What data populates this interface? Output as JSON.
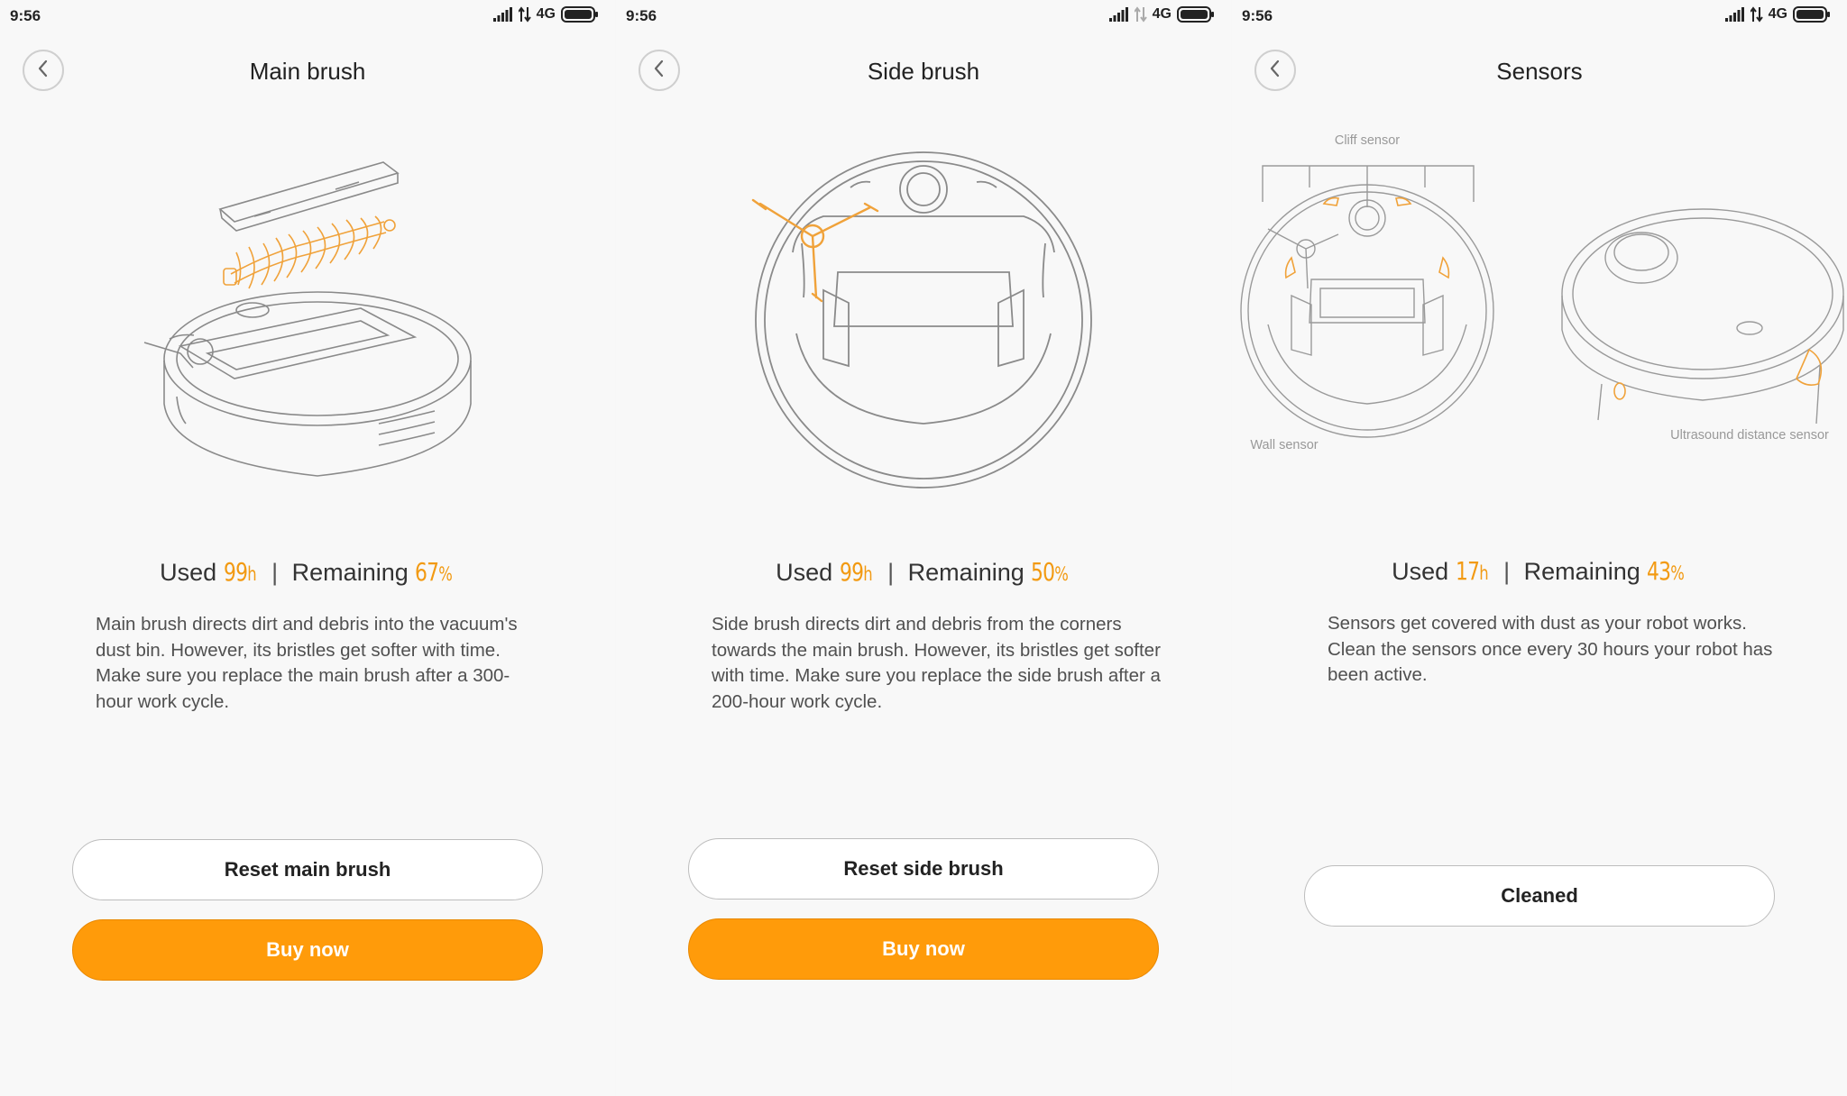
{
  "colors": {
    "accent": "#f29a12",
    "primary_button": "#ff9b0a",
    "background": "#f8f8f8"
  },
  "panels": [
    {
      "status": {
        "time": "9:56",
        "network": "4G"
      },
      "title": "Main brush",
      "usage": {
        "used_label": "Used",
        "used_value": "99",
        "used_unit": "h",
        "remaining_label": "Remaining",
        "remaining_value": "67",
        "remaining_unit": "%"
      },
      "description": "Main brush directs dirt and debris into the vacuum's dust bin. However, its bristles get softer with time. Make sure you replace the main brush after a 300-hour work cycle.",
      "buttons": {
        "reset": "Reset main brush",
        "buy": "Buy now"
      }
    },
    {
      "status": {
        "time": "9:56",
        "network": "4G"
      },
      "title": "Side brush",
      "usage": {
        "used_label": "Used",
        "used_value": "99",
        "used_unit": "h",
        "remaining_label": "Remaining",
        "remaining_value": "50",
        "remaining_unit": "%"
      },
      "description": "Side brush directs dirt and debris from the corners towards the main brush. However, its bristles get softer with time. Make sure you replace the side brush after a 200-hour work cycle.",
      "buttons": {
        "reset": "Reset side brush",
        "buy": "Buy now"
      }
    },
    {
      "status": {
        "time": "9:56",
        "network": "4G"
      },
      "title": "Sensors",
      "sensor_labels": {
        "cliff": "Cliff sensor",
        "wall": "Wall sensor",
        "ultrasound": "Ultrasound distance sensor"
      },
      "usage": {
        "used_label": "Used",
        "used_value": "17",
        "used_unit": "h",
        "remaining_label": "Remaining",
        "remaining_value": "43",
        "remaining_unit": "%"
      },
      "description": "Sensors get covered with dust as your robot works. Clean the sensors once every 30 hours your robot has been active.",
      "buttons": {
        "cleaned": "Cleaned"
      }
    }
  ]
}
